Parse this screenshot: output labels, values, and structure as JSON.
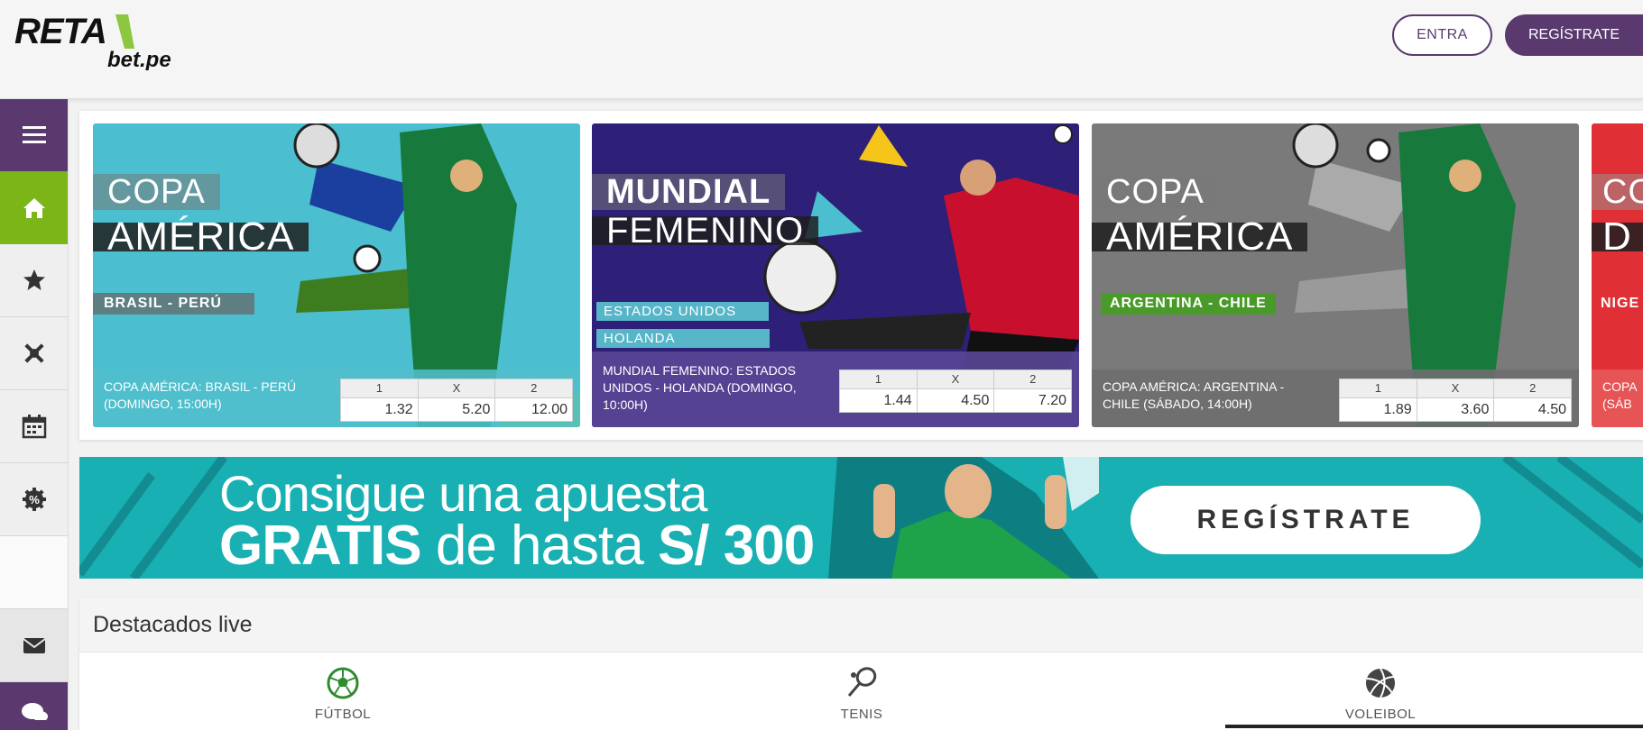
{
  "header": {
    "logo_text": "RETA",
    "logo_sub": "bet.pe",
    "login_label": "ENTRA",
    "register_label": "REGÍSTRATE"
  },
  "sidebar": {
    "items": [
      {
        "icon": "menu-icon"
      },
      {
        "icon": "home-icon",
        "active": true
      },
      {
        "icon": "star-icon"
      },
      {
        "icon": "crossed-tools-icon"
      },
      {
        "icon": "calendar-icon"
      },
      {
        "icon": "gear-percent-icon"
      },
      {
        "icon": "mail-icon"
      },
      {
        "icon": "chat-icon"
      }
    ]
  },
  "carousel": {
    "cards": [
      {
        "title_line1": "COPA",
        "title_line2": "AMÉRICA",
        "tags": [
          "BRASIL - PERÚ"
        ],
        "info": "COPA AMÉRICA: BRASIL - PERÚ (DOMINGO, 15:00H)",
        "odds_head": [
          "1",
          "X",
          "2"
        ],
        "odds": [
          "1.32",
          "5.20",
          "12.00"
        ],
        "bg_color": "#4bbfcf"
      },
      {
        "title_line1": "MUNDIAL",
        "title_line2": "FEMENINO",
        "tags": [
          "ESTADOS UNIDOS",
          "HOLANDA"
        ],
        "info": "MUNDIAL FEMENINO: ESTADOS UNIDOS - HOLANDA (DOMINGO, 10:00H)",
        "odds_head": [
          "1",
          "X",
          "2"
        ],
        "odds": [
          "1.44",
          "4.50",
          "7.20"
        ],
        "bg_color": "#2e1f78"
      },
      {
        "title_line1": "COPA",
        "title_line2": "AMÉRICA",
        "tags": [
          "ARGENTINA - CHILE"
        ],
        "info": "COPA AMÉRICA: ARGENTINA - CHILE (SÁBADO, 14:00H)",
        "odds_head": [
          "1",
          "X",
          "2"
        ],
        "odds": [
          "1.89",
          "3.60",
          "4.50"
        ],
        "bg_color": "#7a7a7a"
      },
      {
        "title_line1": "CO",
        "title_line2": "D",
        "tags": [
          "NIGE"
        ],
        "info": "COPA (SÁB",
        "bg_color": "#e03035"
      }
    ]
  },
  "promo": {
    "line1": "Consigue una apuesta",
    "line2_bold": "GRATIS",
    "line2_mid": " de hasta ",
    "line2_amount": "S/ 300",
    "button_label": "REGÍSTRATE"
  },
  "destacados": {
    "title": "Destacados live",
    "sports": [
      {
        "label": "FÚTBOL",
        "icon": "soccer-ball-icon"
      },
      {
        "label": "TENIS",
        "icon": "tennis-racket-icon"
      },
      {
        "label": "VOLEIBOL",
        "icon": "volleyball-icon",
        "active": true
      }
    ]
  },
  "colors": {
    "brand_purple": "#5a3a6e",
    "brand_green": "#7cb518",
    "promo_teal": "#19b0b3"
  }
}
